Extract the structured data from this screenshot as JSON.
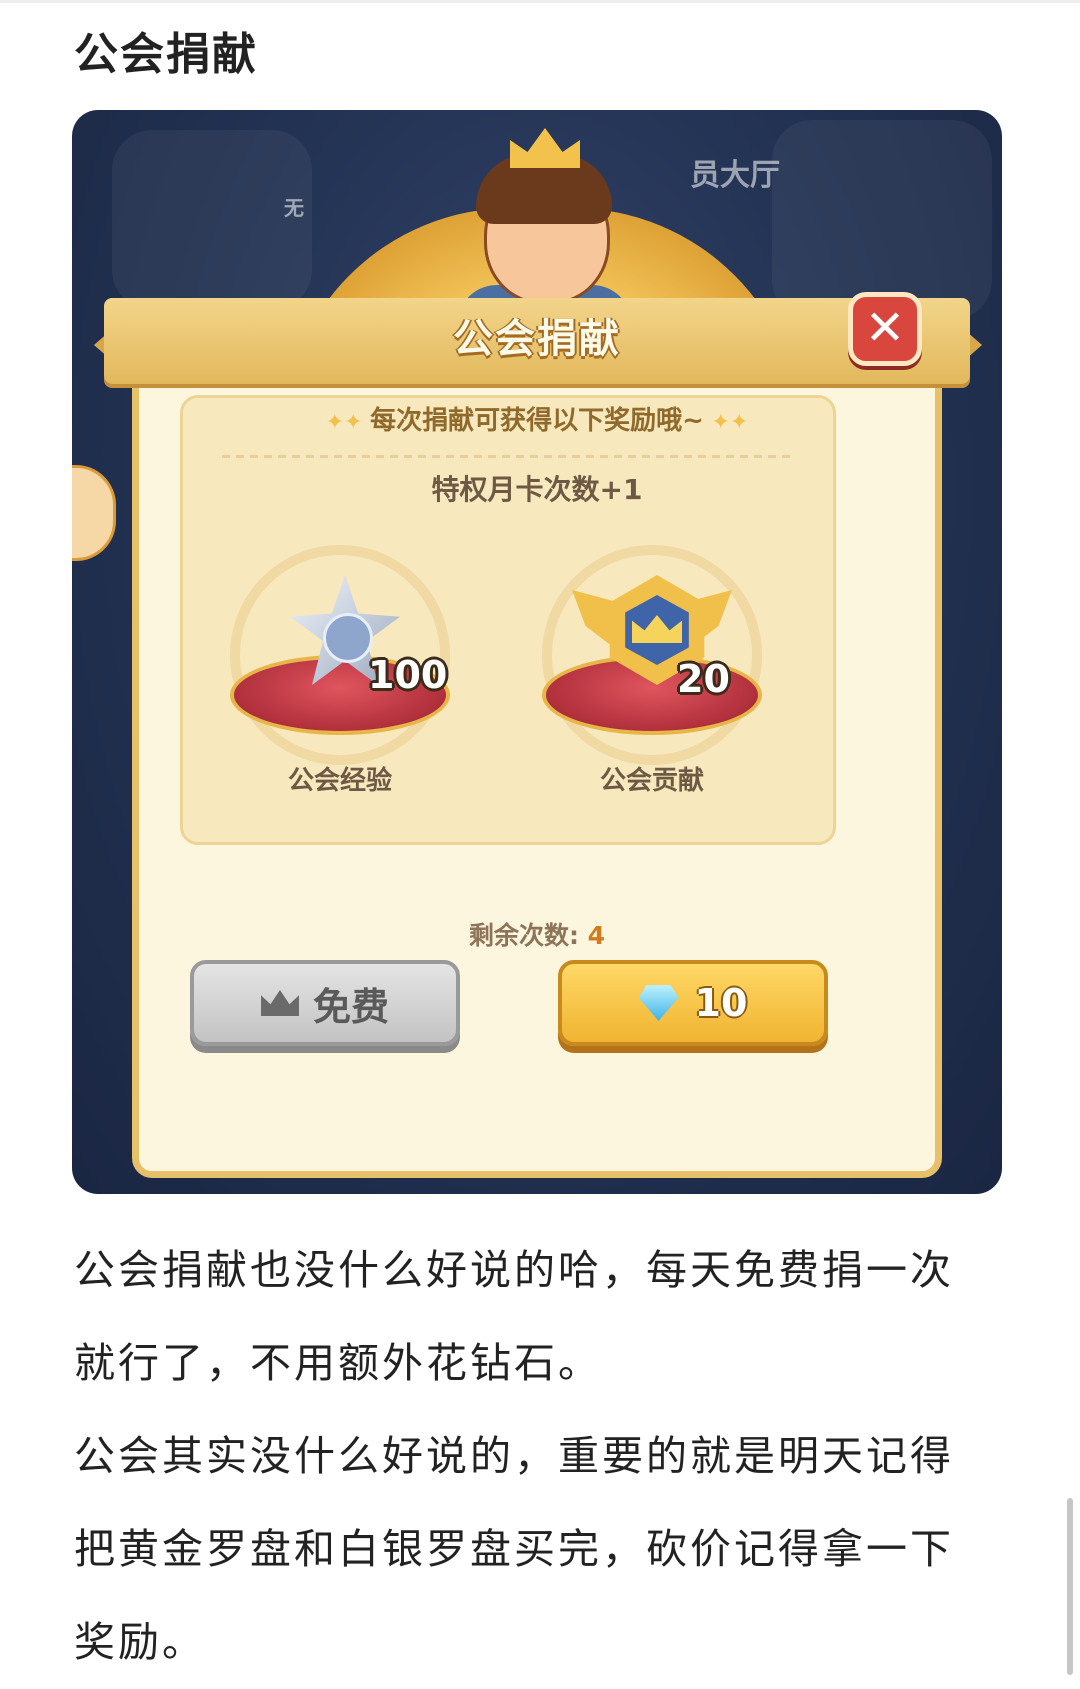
{
  "article": {
    "section_title": "公会捐献",
    "paragraph_1": "公会捐献也没什么好说的哈，每天免费捐一次就行了，不用额外花钻石。",
    "paragraph_2": "公会其实没什么好说的，重要的就是明天记得把黄金罗盘和白银罗盘买完，砍价记得拿一下奖励。"
  },
  "game": {
    "background_labels": {
      "left": "无",
      "right": "员大厅"
    },
    "dialog": {
      "title": "公会捐献",
      "close_icon": "close-x-icon",
      "reward_heading": "每次捐献可获得以下奖励哦~",
      "privilege_text": "特权月卡次数+1",
      "rewards": [
        {
          "icon": "guild-exp-star-icon",
          "quantity": "100",
          "label": "公会经验"
        },
        {
          "icon": "guild-contribution-badge-icon",
          "quantity": "20",
          "label": "公会贡献"
        }
      ],
      "remaining_label": "剩余次数:",
      "remaining_count": "4",
      "buttons": {
        "free": {
          "icon": "crown-icon",
          "label": "免费"
        },
        "diamond": {
          "icon": "diamond-icon",
          "label": "10"
        }
      }
    }
  },
  "colors": {
    "panel_bg": "#fdf6df",
    "ribbon_gold": "#e2b85c",
    "close_red": "#d9463e",
    "remaining_orange": "#d27a1e",
    "game_bg": "#243455"
  }
}
